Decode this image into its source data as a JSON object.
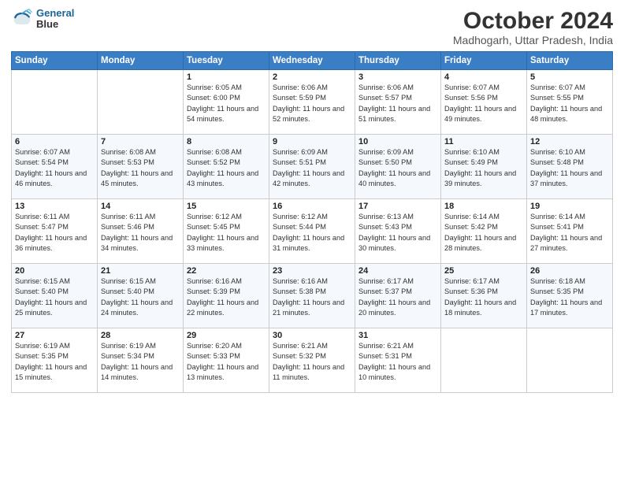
{
  "logo": {
    "line1": "General",
    "line2": "Blue"
  },
  "title": "October 2024",
  "subtitle": "Madhogarh, Uttar Pradesh, India",
  "weekdays": [
    "Sunday",
    "Monday",
    "Tuesday",
    "Wednesday",
    "Thursday",
    "Friday",
    "Saturday"
  ],
  "weeks": [
    [
      {
        "day": "",
        "info": ""
      },
      {
        "day": "",
        "info": ""
      },
      {
        "day": "1",
        "info": "Sunrise: 6:05 AM\nSunset: 6:00 PM\nDaylight: 11 hours and 54 minutes."
      },
      {
        "day": "2",
        "info": "Sunrise: 6:06 AM\nSunset: 5:59 PM\nDaylight: 11 hours and 52 minutes."
      },
      {
        "day": "3",
        "info": "Sunrise: 6:06 AM\nSunset: 5:57 PM\nDaylight: 11 hours and 51 minutes."
      },
      {
        "day": "4",
        "info": "Sunrise: 6:07 AM\nSunset: 5:56 PM\nDaylight: 11 hours and 49 minutes."
      },
      {
        "day": "5",
        "info": "Sunrise: 6:07 AM\nSunset: 5:55 PM\nDaylight: 11 hours and 48 minutes."
      }
    ],
    [
      {
        "day": "6",
        "info": "Sunrise: 6:07 AM\nSunset: 5:54 PM\nDaylight: 11 hours and 46 minutes."
      },
      {
        "day": "7",
        "info": "Sunrise: 6:08 AM\nSunset: 5:53 PM\nDaylight: 11 hours and 45 minutes."
      },
      {
        "day": "8",
        "info": "Sunrise: 6:08 AM\nSunset: 5:52 PM\nDaylight: 11 hours and 43 minutes."
      },
      {
        "day": "9",
        "info": "Sunrise: 6:09 AM\nSunset: 5:51 PM\nDaylight: 11 hours and 42 minutes."
      },
      {
        "day": "10",
        "info": "Sunrise: 6:09 AM\nSunset: 5:50 PM\nDaylight: 11 hours and 40 minutes."
      },
      {
        "day": "11",
        "info": "Sunrise: 6:10 AM\nSunset: 5:49 PM\nDaylight: 11 hours and 39 minutes."
      },
      {
        "day": "12",
        "info": "Sunrise: 6:10 AM\nSunset: 5:48 PM\nDaylight: 11 hours and 37 minutes."
      }
    ],
    [
      {
        "day": "13",
        "info": "Sunrise: 6:11 AM\nSunset: 5:47 PM\nDaylight: 11 hours and 36 minutes."
      },
      {
        "day": "14",
        "info": "Sunrise: 6:11 AM\nSunset: 5:46 PM\nDaylight: 11 hours and 34 minutes."
      },
      {
        "day": "15",
        "info": "Sunrise: 6:12 AM\nSunset: 5:45 PM\nDaylight: 11 hours and 33 minutes."
      },
      {
        "day": "16",
        "info": "Sunrise: 6:12 AM\nSunset: 5:44 PM\nDaylight: 11 hours and 31 minutes."
      },
      {
        "day": "17",
        "info": "Sunrise: 6:13 AM\nSunset: 5:43 PM\nDaylight: 11 hours and 30 minutes."
      },
      {
        "day": "18",
        "info": "Sunrise: 6:14 AM\nSunset: 5:42 PM\nDaylight: 11 hours and 28 minutes."
      },
      {
        "day": "19",
        "info": "Sunrise: 6:14 AM\nSunset: 5:41 PM\nDaylight: 11 hours and 27 minutes."
      }
    ],
    [
      {
        "day": "20",
        "info": "Sunrise: 6:15 AM\nSunset: 5:40 PM\nDaylight: 11 hours and 25 minutes."
      },
      {
        "day": "21",
        "info": "Sunrise: 6:15 AM\nSunset: 5:40 PM\nDaylight: 11 hours and 24 minutes."
      },
      {
        "day": "22",
        "info": "Sunrise: 6:16 AM\nSunset: 5:39 PM\nDaylight: 11 hours and 22 minutes."
      },
      {
        "day": "23",
        "info": "Sunrise: 6:16 AM\nSunset: 5:38 PM\nDaylight: 11 hours and 21 minutes."
      },
      {
        "day": "24",
        "info": "Sunrise: 6:17 AM\nSunset: 5:37 PM\nDaylight: 11 hours and 20 minutes."
      },
      {
        "day": "25",
        "info": "Sunrise: 6:17 AM\nSunset: 5:36 PM\nDaylight: 11 hours and 18 minutes."
      },
      {
        "day": "26",
        "info": "Sunrise: 6:18 AM\nSunset: 5:35 PM\nDaylight: 11 hours and 17 minutes."
      }
    ],
    [
      {
        "day": "27",
        "info": "Sunrise: 6:19 AM\nSunset: 5:35 PM\nDaylight: 11 hours and 15 minutes."
      },
      {
        "day": "28",
        "info": "Sunrise: 6:19 AM\nSunset: 5:34 PM\nDaylight: 11 hours and 14 minutes."
      },
      {
        "day": "29",
        "info": "Sunrise: 6:20 AM\nSunset: 5:33 PM\nDaylight: 11 hours and 13 minutes."
      },
      {
        "day": "30",
        "info": "Sunrise: 6:21 AM\nSunset: 5:32 PM\nDaylight: 11 hours and 11 minutes."
      },
      {
        "day": "31",
        "info": "Sunrise: 6:21 AM\nSunset: 5:31 PM\nDaylight: 11 hours and 10 minutes."
      },
      {
        "day": "",
        "info": ""
      },
      {
        "day": "",
        "info": ""
      }
    ]
  ]
}
